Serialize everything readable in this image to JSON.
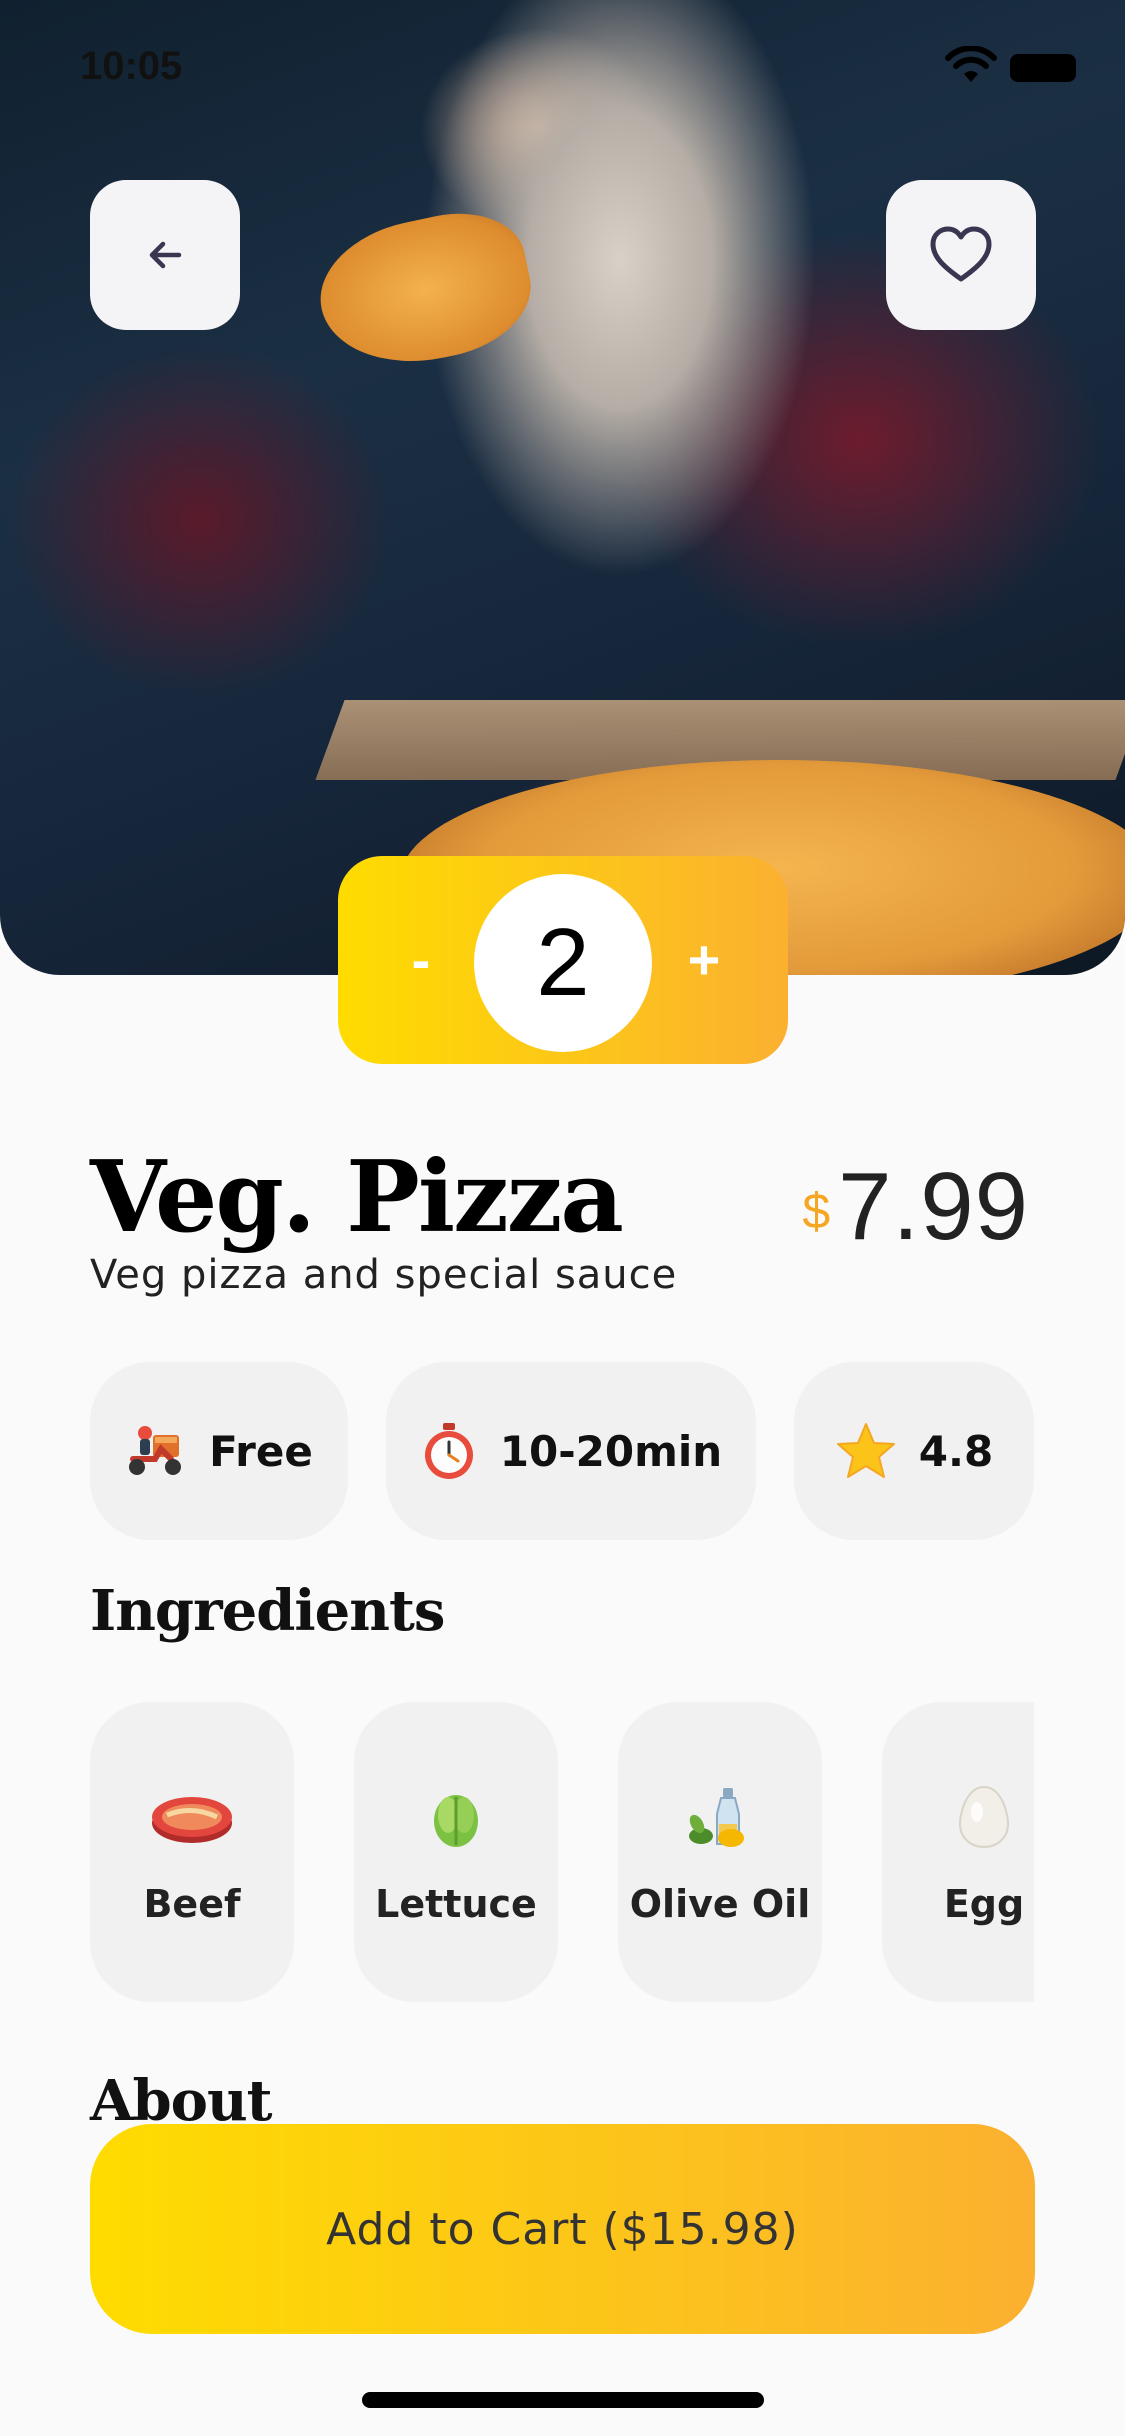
{
  "status_bar": {
    "time": "10:05"
  },
  "hero": {
    "back_icon": "arrow-left-icon",
    "favorite_icon": "heart-outline-icon",
    "image": "woman-eating-pizza-photo"
  },
  "quantity": {
    "minus_label": "-",
    "value": "2",
    "plus_label": "+"
  },
  "product": {
    "name": "Veg. Pizza",
    "description": "Veg pizza and special sauce",
    "currency": "$",
    "price": "7.99"
  },
  "info_chips": [
    {
      "icon": "delivery-scooter-icon",
      "label": "Free"
    },
    {
      "icon": "stopwatch-icon",
      "label": "10-20min"
    },
    {
      "icon": "star-icon",
      "label": "4.8"
    }
  ],
  "ingredients": {
    "title": "Ingredients",
    "items": [
      {
        "icon": "beef-steak-icon",
        "label": "Beef"
      },
      {
        "icon": "lettuce-icon",
        "label": "Lettuce"
      },
      {
        "icon": "olive-oil-icon",
        "label": "Olive Oil"
      },
      {
        "icon": "egg-icon",
        "label": "Egg"
      }
    ]
  },
  "about": {
    "title": "About"
  },
  "cart": {
    "label": "Add to Cart ($15.98)"
  },
  "colors": {
    "accent_start": "#ffdc00",
    "accent_end": "#fbb030",
    "price_currency": "#f5a623",
    "card_bg": "#f1f1f1"
  }
}
